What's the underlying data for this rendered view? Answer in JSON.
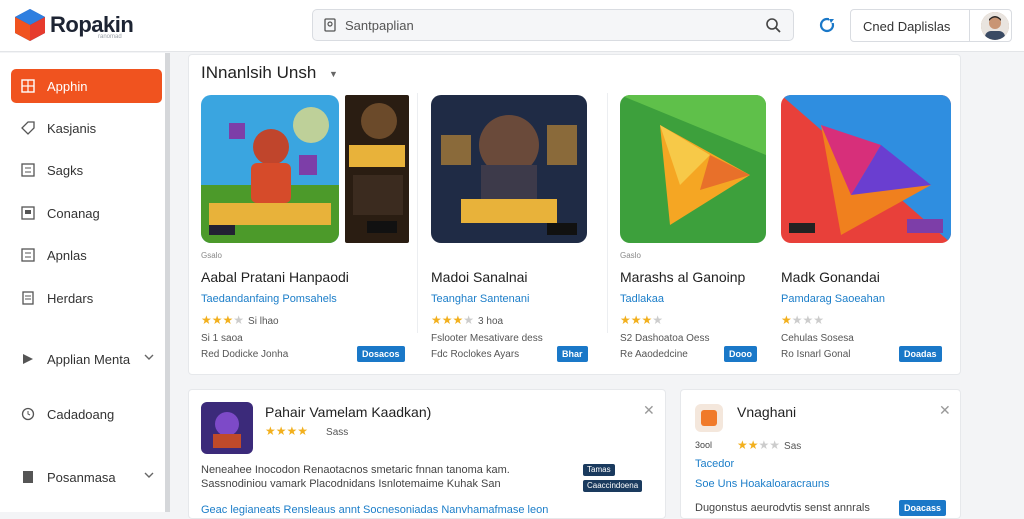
{
  "header": {
    "brand": "Ropakin",
    "brand_sub": "ranomad",
    "search_placeholder": "Santpaplian",
    "user_name": "Cned Daplislas"
  },
  "sidebar": {
    "items": [
      {
        "label": "Apphin",
        "icon": "grid-icon"
      },
      {
        "label": "Kasjanis",
        "icon": "tag-icon"
      },
      {
        "label": "Sagks",
        "icon": "list-icon"
      },
      {
        "label": "Conanag",
        "icon": "square-icon"
      },
      {
        "label": "Apnlas",
        "icon": "list-icon"
      },
      {
        "label": "Herdars",
        "icon": "document-icon"
      },
      {
        "label": "Applian Menta",
        "icon": "puzzle-icon"
      },
      {
        "label": "Cadadoang",
        "icon": "clock-icon"
      },
      {
        "label": "Posanmasa",
        "icon": "document-icon"
      }
    ]
  },
  "section": {
    "title": "INnanlsih Unsh"
  },
  "apps": [
    {
      "category": "Gsalo",
      "name": "Aabal Pratani Hanpaodi",
      "developer": "Taedandanfaing Pomsahels",
      "rating_count": "Si lhao",
      "meta1": "Si 1 saoa",
      "meta2": "Red Dodicke Jonha",
      "button": "Dosacos"
    },
    {
      "category": "",
      "name": "Madoi Sanalnai",
      "developer": "Teanghar Santenani",
      "rating_count": "3 hoa",
      "meta1": "Fslooter Mesativare dess",
      "meta2": "Fdc Roclokes Ayars",
      "button": "Bhar"
    },
    {
      "category": "Gaslo",
      "name": "Marashs al Ganoinp",
      "developer": "Tadlakaa",
      "rating_count": "",
      "meta1": "S2 Dashoatoa Oess",
      "meta2": "Re Aaodedcine",
      "button": "Dooo"
    },
    {
      "category": "",
      "name": "Madk Gonandai",
      "developer": "Pamdarag Saoeahan",
      "rating_count": "",
      "meta1": "Cehulas Sosesa",
      "meta2": "Ro Isnarl Gonal",
      "button": "Doadas"
    }
  ],
  "card2": {
    "title": "Pahair Vamelam Kaadkan)",
    "rating_count": "Sass",
    "text1": "Neneahee Inocodon Renaotacnos smetaric fnnan tanoma kam.",
    "text2": "Sassnodiniou vamark Placodnidans Isnlotemaime Kuhak San",
    "text3": "Geac legianeats Rensleaus annt Socnesoniadas Nanvhamafmase leon",
    "badge1": "Tamas",
    "badge2": "Caaccindoena"
  },
  "card3": {
    "title": "Vnaghani",
    "meta": "3ool",
    "rating_count": "Sas",
    "link1": "Tacedor",
    "link2": "Soe Uns Hoakaloaracrauns",
    "text3": "Dugonstus aeurodvtis senst annrals",
    "button": "Doacass"
  },
  "colors": {
    "accent": "#f0531f",
    "link": "#1c7ec9",
    "button": "#1a78c8",
    "star": "#f2b01e"
  }
}
